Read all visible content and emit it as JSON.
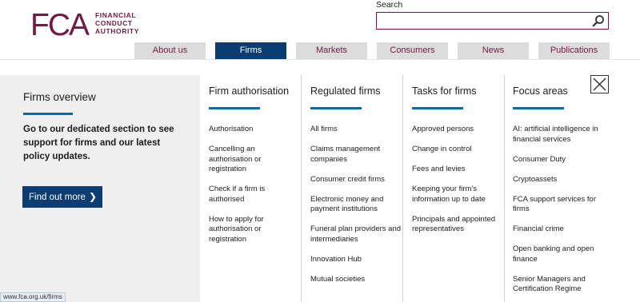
{
  "brand": {
    "logo_letters": "FCA",
    "logo_text_lines": [
      "FINANCIAL",
      "CONDUCT",
      "AUTHORITY"
    ],
    "color": "#701b45"
  },
  "search": {
    "label": "Search",
    "value": "",
    "placeholder": "",
    "icon": "search-icon"
  },
  "nav": {
    "tabs": [
      {
        "label": "About us",
        "active": false
      },
      {
        "label": "Firms",
        "active": true
      },
      {
        "label": "Markets",
        "active": false
      },
      {
        "label": "Consumers",
        "active": false
      },
      {
        "label": "News",
        "active": false
      },
      {
        "label": "Publications",
        "active": false
      }
    ]
  },
  "overview": {
    "title": "Firms overview",
    "description": "Go to our dedicated section to see support for firms and our latest policy updates.",
    "button_label": "Find out more",
    "button_icon": "chevron-right-icon"
  },
  "columns": [
    {
      "title": "Firm authorisation",
      "items": [
        "Authorisation",
        "Cancelling an authorisation or registration",
        "Check if a firm is authorised",
        "How to apply for authorisation or registration"
      ]
    },
    {
      "title": "Regulated firms",
      "items": [
        "All firms",
        "Claims management companies",
        "Consumer credit firms",
        "Electronic money and payment institutions",
        "Funeral plan providers and intermediaries",
        "Innovation Hub",
        "Mutual societies"
      ]
    },
    {
      "title": "Tasks for firms",
      "items": [
        "Approved persons",
        "Change in control",
        "Fees and levies",
        "Keeping your firm's information up to date",
        "Principals and appointed representatives"
      ]
    },
    {
      "title": "Focus areas",
      "items": [
        "AI: artificial intelligence in financial services",
        "Consumer Duty",
        "Cryptoassets",
        "FCA support services for firms",
        "Financial crime",
        "Open banking and open finance",
        "Senior Managers and Certification Regime"
      ]
    }
  ],
  "close_icon": "close-icon",
  "status_url": "www.fca.org.uk/firms",
  "colors": {
    "accent": "#0b3d72",
    "bar": "#0b6a9f",
    "panel_bg": "#efefef",
    "tab_bg": "#dcdcdc"
  }
}
